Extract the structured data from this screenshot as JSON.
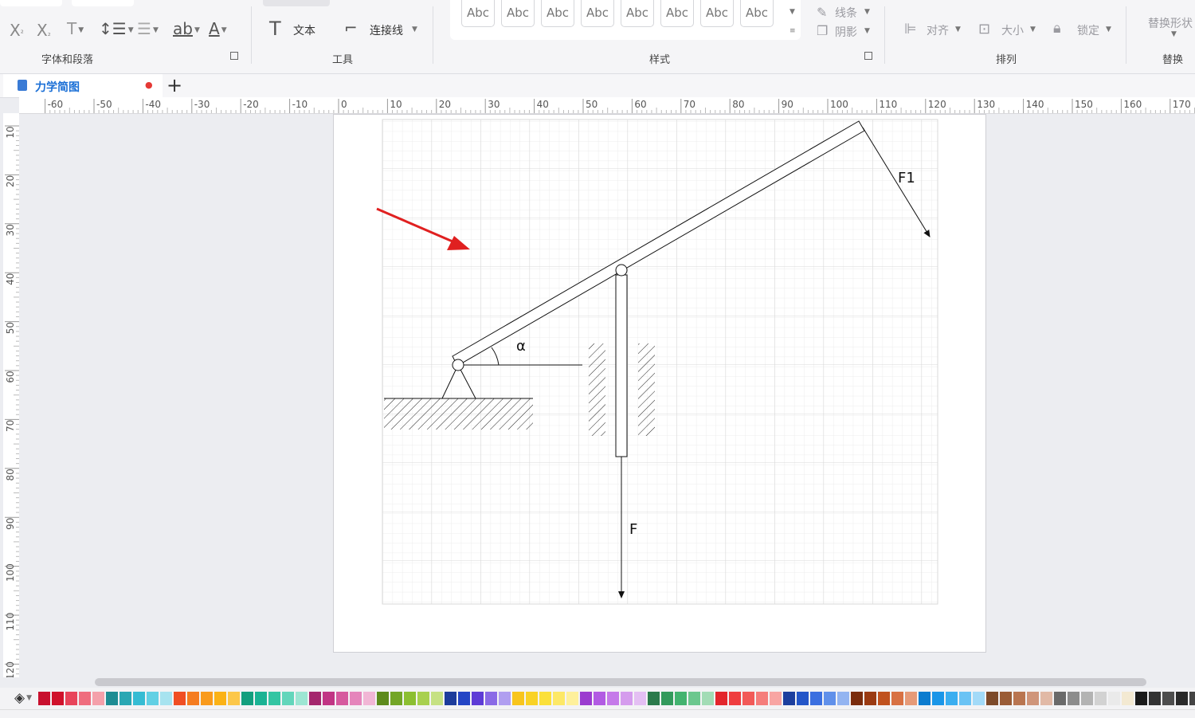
{
  "ribbon": {
    "groups": {
      "font_paragraph": "字体和段落",
      "tools": "工具",
      "styles": "样式",
      "arrange": "排列",
      "replace": "替换"
    },
    "tools": {
      "text_label": "文本",
      "connector_label": "连接线"
    },
    "style_samples": [
      "Abc",
      "Abc",
      "Abc",
      "Abc",
      "Abc",
      "Abc",
      "Abc",
      "Abc"
    ],
    "line_label": "线条",
    "shadow_label": "阴影",
    "align_label": "对齐",
    "size_label": "大小",
    "lock_label": "锁定",
    "replace_shape_label": "替换形状"
  },
  "tab": {
    "title": "力学简图",
    "unsaved_dot": "●",
    "add": "+"
  },
  "ruler": {
    "horizontal": [
      "-60",
      "-50",
      "-40",
      "-30",
      "-20",
      "-10",
      "0",
      "10",
      "20",
      "30",
      "40",
      "50",
      "60",
      "70",
      "80",
      "90",
      "100",
      "110",
      "120",
      "130",
      "140",
      "150",
      "160",
      "170"
    ],
    "vertical": [
      "10",
      "20",
      "30",
      "40",
      "50",
      "60",
      "70",
      "80",
      "90",
      "100",
      "110",
      "120"
    ]
  },
  "diagram": {
    "force1": "F1",
    "force": "F",
    "angle": "α"
  },
  "palette": {
    "colors": [
      "#c8102e",
      "#d0112b",
      "#e8445a",
      "#ef6d7e",
      "#f4a0aa",
      "#1e8c93",
      "#2aa7b3",
      "#36bcd3",
      "#62d0e4",
      "#a7e3ef",
      "#f04e23",
      "#f57c20",
      "#f99a1c",
      "#fbb216",
      "#fcc74a",
      "#139f7e",
      "#1ab394",
      "#34c5a3",
      "#63d6bb",
      "#9de6d3",
      "#a4276d",
      "#c13584",
      "#d65a9e",
      "#e585bb",
      "#f1b6d5",
      "#5d8a1c",
      "#73a526",
      "#8cbf31",
      "#a8d04f",
      "#c6e183",
      "#1d3c9b",
      "#2445c5",
      "#5e3cd6",
      "#8a6ae6",
      "#b09ef0",
      "#f8c51c",
      "#f9d225",
      "#fbe03a",
      "#fde866",
      "#fef09b",
      "#9b3ccf",
      "#b25be3",
      "#c57ae9",
      "#d59ced",
      "#e4bff3",
      "#2b7a4b",
      "#339a5c",
      "#43b36f",
      "#6cc78e",
      "#a2dcb5",
      "#e3262c",
      "#ef3d3f",
      "#f25a58",
      "#f57d7b",
      "#f8a5a3",
      "#1d3f9e",
      "#2456c8",
      "#3b6fe0",
      "#6090ea",
      "#93b4f1",
      "#7a2c0d",
      "#9a3a12",
      "#c0521f",
      "#d87143",
      "#e69a78",
      "#0c7ccf",
      "#1a96e8",
      "#3aaef0",
      "#6ac3f4",
      "#a2daf8",
      "#7d4a2a",
      "#9a5c36",
      "#b97550",
      "#cf957a",
      "#e1b9a6",
      "#6a6a6a",
      "#8c8c8c",
      "#b3b3b3",
      "#d2d2d2",
      "#eaeaea",
      "#f3e9d2",
      "#1a1a1a",
      "#333333",
      "#4d4d4d",
      "#2a2a2a",
      "#444444"
    ]
  }
}
